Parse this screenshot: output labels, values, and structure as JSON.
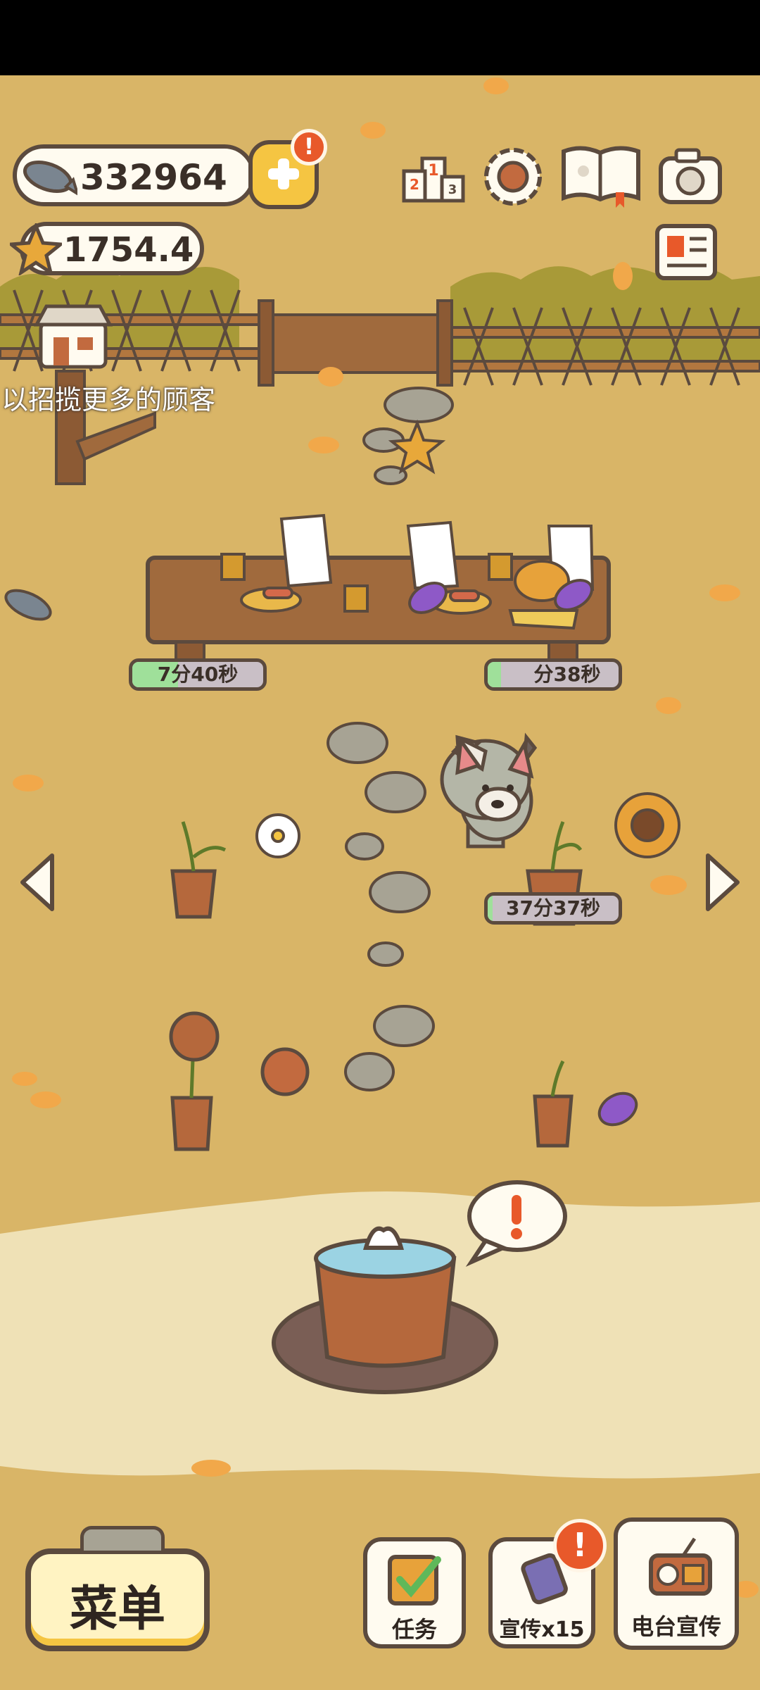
{
  "currency": {
    "fish_count": "332964",
    "star_count": "1754.4"
  },
  "banner_text": "以招揽更多的顾客",
  "timers": [
    {
      "text": "7分40秒",
      "progress": 0.35
    },
    {
      "text": "分38秒",
      "progress": 0.1
    },
    {
      "text": "37分37秒",
      "progress": 0.04
    }
  ],
  "alert": {
    "badge": "!"
  },
  "bottom_bar": {
    "menu_label": "菜单",
    "tasks_label": "任务",
    "promo_label": "宣传x15",
    "radio_label": "电台宣传"
  },
  "colors": {
    "ground": "#D9B567",
    "path": "#EFE1B6",
    "outline": "#5B4A3E",
    "accent": "#F5C542",
    "badge": "#E8592A"
  },
  "icons": [
    "fish-icon",
    "plus-icon",
    "star-icon",
    "ranking-icon",
    "settings-gear-icon",
    "recipe-book-icon",
    "camera-icon",
    "newspaper-icon",
    "shop-icon",
    "left-arrow-icon",
    "right-arrow-icon",
    "checklist-icon",
    "radio-icon"
  ]
}
